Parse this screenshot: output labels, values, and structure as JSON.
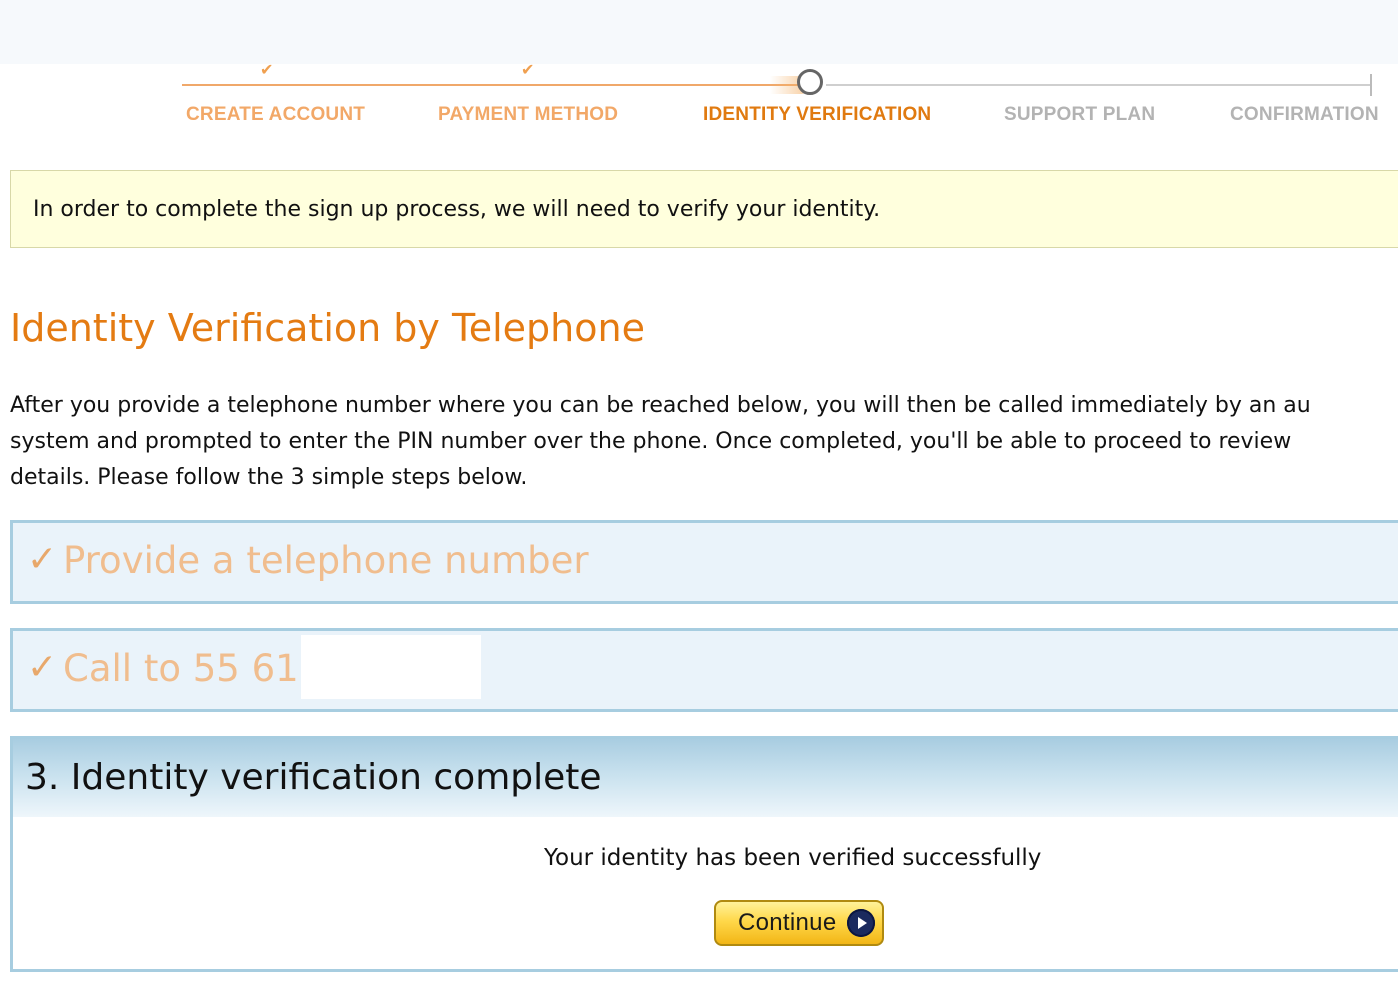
{
  "progress": {
    "steps": [
      {
        "label": "CREATE ACCOUNT",
        "state": "done"
      },
      {
        "label": "PAYMENT METHOD",
        "state": "done"
      },
      {
        "label": "IDENTITY VERIFICATION",
        "state": "current"
      },
      {
        "label": "SUPPORT PLAN",
        "state": "pending"
      },
      {
        "label": "CONFIRMATION",
        "state": "pending"
      }
    ],
    "done_mark": "✔",
    "completed_fraction": 0.4
  },
  "notice": {
    "text": "In order to complete the sign up process, we will need to verify your identity."
  },
  "page_title": "Identity Verification by Telephone",
  "intro": {
    "lines": [
      "After you provide a telephone number where you can be reached below, you will then be called immediately by an au",
      "system and prompted to enter the PIN number over the phone. Once completed, you'll be able to proceed to review",
      "details. Please follow the 3 simple steps below."
    ]
  },
  "panels": {
    "step1": {
      "check": "✓",
      "title": "Provide a telephone number"
    },
    "step2": {
      "check": "✓",
      "title": "Call to 55 613"
    },
    "step3": {
      "title": "3. Identity verification complete",
      "message": "Your identity has been verified successfully",
      "button_label": "Continue"
    }
  },
  "colors": {
    "accent": "#e47b12",
    "done": "#f2a868",
    "pending": "#b3b3b3",
    "panel_border": "#a7cde0",
    "notice_bg": "#ffffdd"
  },
  "icons": {
    "current_step": "circle-icon",
    "continue": "play-arrow-icon"
  }
}
